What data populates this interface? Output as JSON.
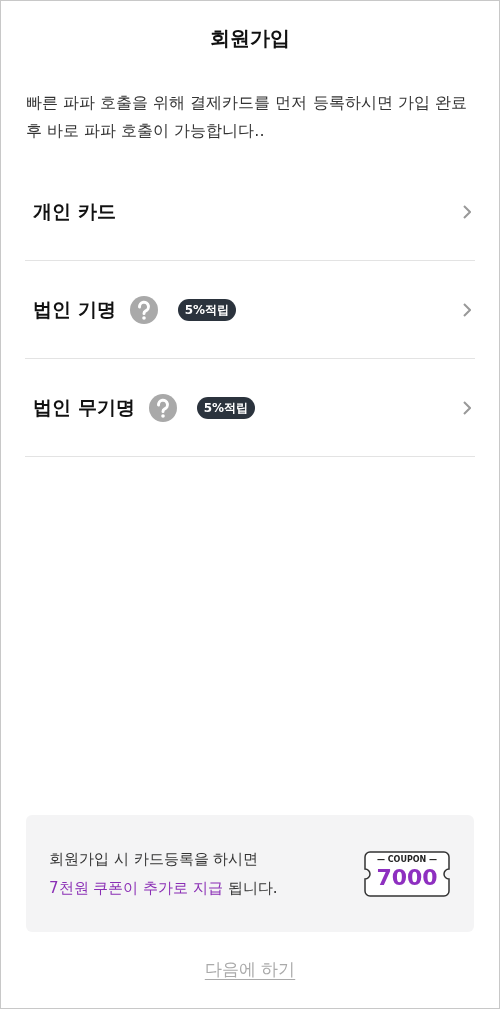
{
  "title": "회원가입",
  "description": "빠른 파파 호출을 위해 결제카드를 먼저 등록하시면 가입 완료 후 바로 파파 호출이 가능합니다..",
  "options": [
    {
      "label": "개인 카드",
      "help": false
    },
    {
      "label": "법인 기명",
      "help": true,
      "badge": "5%적립"
    },
    {
      "label": "법인 무기명",
      "help": true,
      "badge": "5%적립"
    }
  ],
  "promo": {
    "line1": "회원가입 시 카드등록을 하시면",
    "highlight": "7천원 쿠폰이 추가로 지급",
    "rest": "됩니다.",
    "coupon_label": "— COUPON —",
    "coupon_value": "7000"
  },
  "skip_link": "다음에 하기"
}
